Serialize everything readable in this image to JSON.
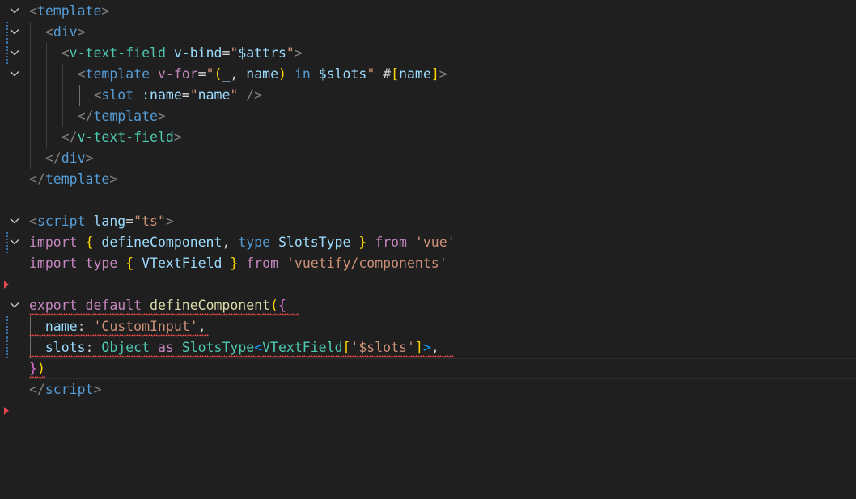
{
  "editor": {
    "language": "vue",
    "lines": [
      {
        "tokens": [
          [
            "t-tag",
            "<"
          ],
          [
            "t-name",
            "template"
          ],
          [
            "t-tag",
            ">"
          ]
        ]
      },
      {
        "tokens": [
          [
            "t-tag",
            "  <"
          ],
          [
            "t-name",
            "div"
          ],
          [
            "t-tag",
            ">"
          ]
        ]
      },
      {
        "tokens": [
          [
            "t-tag",
            "    <"
          ],
          [
            "t-comp",
            "v-text-field"
          ],
          [
            "t-eq",
            " "
          ],
          [
            "t-attr",
            "v-bind"
          ],
          [
            "t-eq",
            "="
          ],
          [
            "t-str",
            "\""
          ],
          [
            "t-var",
            "$attrs"
          ],
          [
            "t-str",
            "\""
          ],
          [
            "t-tag",
            ">"
          ]
        ]
      },
      {
        "tokens": [
          [
            "t-tag",
            "      <"
          ],
          [
            "t-name",
            "template"
          ],
          [
            "t-eq",
            " "
          ],
          [
            "t-kw",
            "v-for"
          ],
          [
            "t-eq",
            "="
          ],
          [
            "t-str",
            "\""
          ],
          [
            "t-brace1",
            "("
          ],
          [
            "t-var",
            "_"
          ],
          [
            "t-punc",
            ", "
          ],
          [
            "t-var",
            "name"
          ],
          [
            "t-brace1",
            ")"
          ],
          [
            "t-eq",
            " "
          ],
          [
            "t-kwb",
            "in"
          ],
          [
            "t-eq",
            " "
          ],
          [
            "t-var",
            "$slots"
          ],
          [
            "t-str",
            "\""
          ],
          [
            "t-eq",
            " "
          ],
          [
            "t-punc",
            "#"
          ],
          [
            "t-brace1",
            "["
          ],
          [
            "t-var",
            "name"
          ],
          [
            "t-brace1",
            "]"
          ],
          [
            "t-tag",
            ">"
          ]
        ]
      },
      {
        "tokens": [
          [
            "t-tag",
            "        <"
          ],
          [
            "t-name",
            "slot"
          ],
          [
            "t-eq",
            " "
          ],
          [
            "t-attr",
            ":name"
          ],
          [
            "t-eq",
            "="
          ],
          [
            "t-str",
            "\""
          ],
          [
            "t-var",
            "name"
          ],
          [
            "t-str",
            "\""
          ],
          [
            "t-eq",
            " "
          ],
          [
            "t-tag",
            "/>"
          ]
        ]
      },
      {
        "tokens": [
          [
            "t-tag",
            "      </"
          ],
          [
            "t-name",
            "template"
          ],
          [
            "t-tag",
            ">"
          ]
        ]
      },
      {
        "tokens": [
          [
            "t-tag",
            "    </"
          ],
          [
            "t-comp",
            "v-text-field"
          ],
          [
            "t-tag",
            ">"
          ]
        ]
      },
      {
        "tokens": [
          [
            "t-tag",
            "  </"
          ],
          [
            "t-name",
            "div"
          ],
          [
            "t-tag",
            ">"
          ]
        ]
      },
      {
        "tokens": [
          [
            "t-tag",
            "</"
          ],
          [
            "t-name",
            "template"
          ],
          [
            "t-tag",
            ">"
          ]
        ]
      },
      {
        "tokens": []
      },
      {
        "tokens": [
          [
            "t-tag",
            "<"
          ],
          [
            "t-name",
            "script"
          ],
          [
            "t-eq",
            " "
          ],
          [
            "t-attr",
            "lang"
          ],
          [
            "t-eq",
            "="
          ],
          [
            "t-str",
            "\"ts\""
          ],
          [
            "t-tag",
            ">"
          ]
        ]
      },
      {
        "tokens": [
          [
            "t-kw",
            "import"
          ],
          [
            "t-eq",
            " "
          ],
          [
            "t-brace1",
            "{"
          ],
          [
            "t-eq",
            " "
          ],
          [
            "t-var",
            "defineComponent"
          ],
          [
            "t-punc",
            ", "
          ],
          [
            "t-kwb",
            "type"
          ],
          [
            "t-eq",
            " "
          ],
          [
            "t-var",
            "SlotsType"
          ],
          [
            "t-eq",
            " "
          ],
          [
            "t-brace1",
            "}"
          ],
          [
            "t-eq",
            " "
          ],
          [
            "t-kw",
            "from"
          ],
          [
            "t-eq",
            " "
          ],
          [
            "t-str",
            "'vue'"
          ]
        ]
      },
      {
        "tokens": [
          [
            "t-kw",
            "import"
          ],
          [
            "t-eq",
            " "
          ],
          [
            "t-kw",
            "type"
          ],
          [
            "t-eq",
            " "
          ],
          [
            "t-brace1",
            "{"
          ],
          [
            "t-eq",
            " "
          ],
          [
            "t-var",
            "VTextField"
          ],
          [
            "t-eq",
            " "
          ],
          [
            "t-brace1",
            "}"
          ],
          [
            "t-eq",
            " "
          ],
          [
            "t-kw",
            "from"
          ],
          [
            "t-eq",
            " "
          ],
          [
            "t-str",
            "'vuetify/components'"
          ]
        ]
      },
      {
        "tokens": []
      },
      {
        "tokens": [
          [
            "t-kw",
            "export"
          ],
          [
            "t-eq",
            " "
          ],
          [
            "t-kw",
            "default"
          ],
          [
            "t-eq",
            " "
          ],
          [
            "t-fn",
            "defineComponent"
          ],
          [
            "t-brace1",
            "("
          ],
          [
            "t-brace2",
            "{"
          ]
        ]
      },
      {
        "tokens": [
          [
            "t-var",
            "  name"
          ],
          [
            "t-punc",
            ": "
          ],
          [
            "t-str",
            "'CustomInput'"
          ],
          [
            "t-punc",
            ","
          ]
        ]
      },
      {
        "tokens": [
          [
            "t-var",
            "  slots"
          ],
          [
            "t-punc",
            ": "
          ],
          [
            "t-type",
            "Object"
          ],
          [
            "t-eq",
            " "
          ],
          [
            "t-kw",
            "as"
          ],
          [
            "t-eq",
            " "
          ],
          [
            "t-type",
            "SlotsType"
          ],
          [
            "t-brace3",
            "<"
          ],
          [
            "t-type",
            "VTextField"
          ],
          [
            "t-brace1",
            "["
          ],
          [
            "t-str",
            "'$slots'"
          ],
          [
            "t-brace1",
            "]"
          ],
          [
            "t-brace3",
            ">"
          ],
          [
            "t-punc",
            ","
          ]
        ]
      },
      {
        "tokens": [
          [
            "t-brace2",
            "}"
          ],
          [
            "t-brace1",
            ")"
          ]
        ]
      },
      {
        "tokens": [
          [
            "t-tag",
            "</"
          ],
          [
            "t-name",
            "script"
          ],
          [
            "t-tag",
            ">"
          ]
        ]
      }
    ]
  }
}
